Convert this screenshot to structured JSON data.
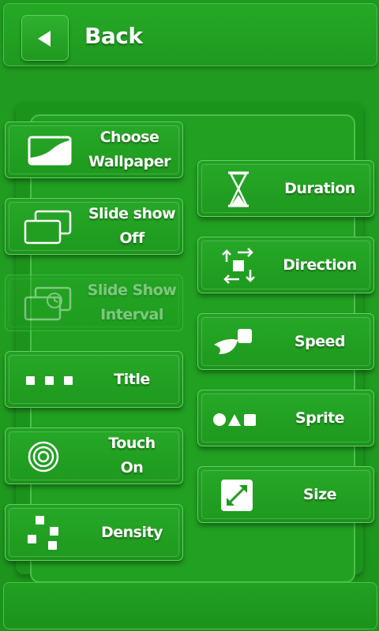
{
  "header": {
    "back_label": "Back"
  },
  "left_buttons": [
    {
      "line1": "Choose",
      "line2": "Wallpaper",
      "icon": "wallpaper-icon",
      "enabled": true
    },
    {
      "line1": "Slide show",
      "line2": "Off",
      "icon": "slideshow-icon",
      "enabled": true
    },
    {
      "line1": "Slide Show",
      "line2": "Interval",
      "icon": "interval-icon",
      "enabled": false
    },
    {
      "line1": "Title",
      "line2": "",
      "icon": "dots-icon",
      "enabled": true
    },
    {
      "line1": "Touch",
      "line2": "On",
      "icon": "target-icon",
      "enabled": true
    },
    {
      "line1": "Density",
      "line2": "",
      "icon": "density-icon",
      "enabled": true
    }
  ],
  "right_buttons": [
    {
      "label": "Duration",
      "icon": "hourglass-icon"
    },
    {
      "label": "Direction",
      "icon": "arrows-icon"
    },
    {
      "label": "Speed",
      "icon": "speed-icon"
    },
    {
      "label": "Sprite",
      "icon": "shapes-icon"
    },
    {
      "label": "Size",
      "icon": "resize-icon"
    }
  ],
  "colors": {
    "background": "#1f9a1f",
    "button": "#24a424",
    "border": "#5fd55f",
    "text": "#ffffff"
  }
}
